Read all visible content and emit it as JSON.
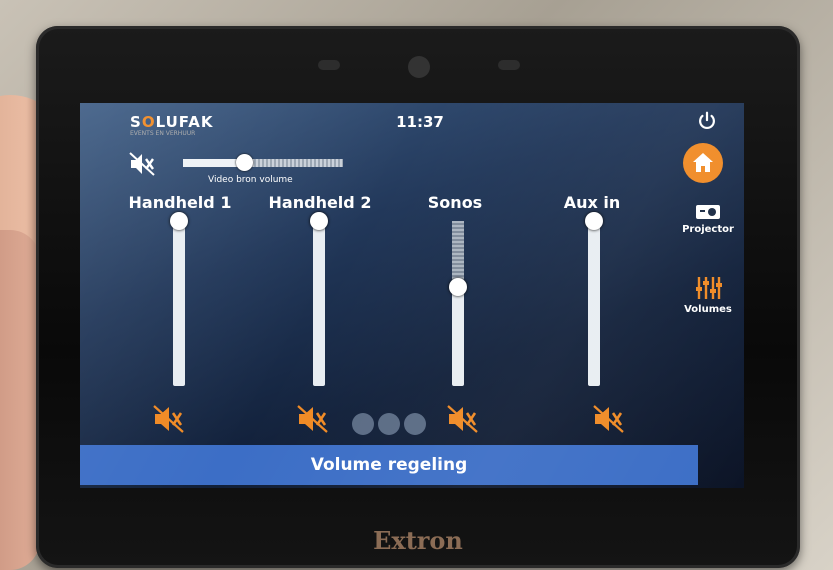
{
  "device": {
    "brand": "Extron"
  },
  "header": {
    "logo": "SOLUFAK",
    "logo_sub": "EVENTS EN VERHUUR",
    "time": "11:37"
  },
  "master": {
    "label": "Video bron volume",
    "value": 0.38,
    "muted": true
  },
  "channels": [
    {
      "name": "Handheld 1",
      "level": 1.0,
      "muted": true
    },
    {
      "name": "Handheld 2",
      "level": 1.0,
      "muted": true
    },
    {
      "name": "Sonos",
      "level": 0.6,
      "muted": true
    },
    {
      "name": "Aux in",
      "level": 1.0,
      "muted": true
    }
  ],
  "nav": {
    "home": {
      "icon": "home-icon"
    },
    "projector": {
      "label": "Projector",
      "icon": "projector-icon"
    },
    "volumes": {
      "label": "Volumes",
      "icon": "sliders-icon"
    }
  },
  "footer": {
    "title": "Volume regeling"
  },
  "colors": {
    "accent": "#f08a24",
    "footer_bar": "#3c6ec6",
    "mute_icon": "#f08a24"
  }
}
